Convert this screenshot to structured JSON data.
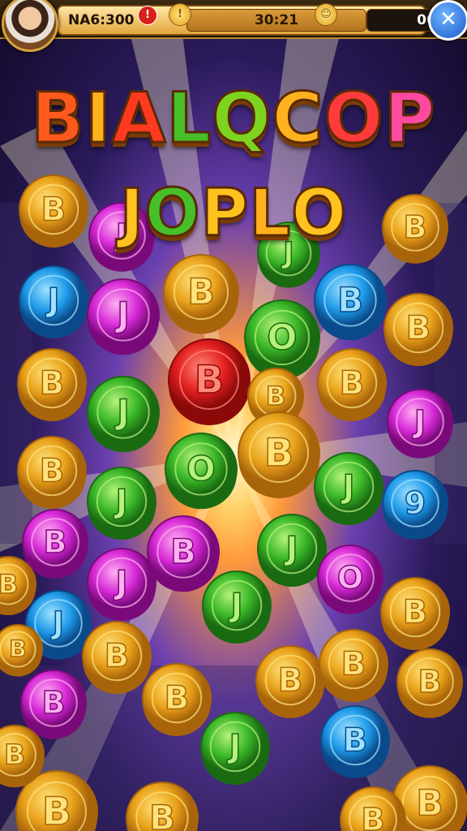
{
  "hud": {
    "player_name": "NA6:300",
    "alert_glyph": "!",
    "coin_glyph": "!",
    "timer": "30:21",
    "score_glyph": "☺",
    "score": "00",
    "close_glyph": "✕"
  },
  "title": {
    "line1": [
      {
        "ch": "B",
        "color": "#ff5a1e"
      },
      {
        "ch": "I",
        "color": "#ffb21e"
      },
      {
        "ch": "A",
        "color": "#ff3a1e"
      },
      {
        "ch": "L",
        "color": "#46c028"
      },
      {
        "ch": "Q",
        "color": "#7ed321"
      },
      {
        "ch": "C",
        "color": "#ffb21e"
      },
      {
        "ch": "O",
        "color": "#ff3a3a"
      },
      {
        "ch": "P",
        "color": "#ff4aa0"
      }
    ],
    "line2": [
      {
        "ch": "J",
        "color": "#ffc21e"
      },
      {
        "ch": "O",
        "color": "#46c028"
      },
      {
        "ch": "P",
        "color": "#ffc21e"
      },
      {
        "ch": "L",
        "color": "#ffb21e"
      },
      {
        "ch": "O",
        "color": "#ffc21e"
      }
    ]
  },
  "palette": {
    "gold": [
      "#ffe37a",
      "#e9a21a",
      "#a8640a"
    ],
    "red": [
      "#ff8a7a",
      "#e21e1e",
      "#8a0a0a"
    ],
    "green": [
      "#b6f27a",
      "#3ab828",
      "#1a6a12"
    ],
    "blue": [
      "#9ee2ff",
      "#1e9ae8",
      "#0a4a8a"
    ],
    "purple": [
      "#ffb0f0",
      "#d82ad8",
      "#7a0a7a"
    ],
    "cyan": [
      "#a8f4ff",
      "#24b8e0",
      "#0a5a7a"
    ]
  },
  "coins": [
    {
      "g": "B",
      "c": "gold"
    },
    {
      "g": "J",
      "c": "purple"
    },
    {
      "g": "J",
      "c": "green"
    },
    {
      "g": "B",
      "c": "gold"
    },
    {
      "g": "J",
      "c": "purple"
    },
    {
      "g": "J",
      "c": "blue"
    },
    {
      "g": "J",
      "c": "purple"
    },
    {
      "g": "B",
      "c": "gold"
    },
    {
      "g": "O",
      "c": "green"
    },
    {
      "g": "B",
      "c": "blue"
    },
    {
      "g": "B",
      "c": "gold"
    },
    {
      "g": "B",
      "c": "gold"
    },
    {
      "g": "B",
      "c": "red"
    },
    {
      "g": "B",
      "c": "gold"
    },
    {
      "g": "B",
      "c": "gold"
    },
    {
      "g": "J",
      "c": "purple"
    },
    {
      "g": "J",
      "c": "green"
    },
    {
      "g": "O",
      "c": "green"
    },
    {
      "g": "B",
      "c": "gold"
    },
    {
      "g": "J",
      "c": "green"
    },
    {
      "g": "B",
      "c": "gold"
    },
    {
      "g": "J",
      "c": "green"
    },
    {
      "g": "9",
      "c": "blue"
    },
    {
      "g": "B",
      "c": "purple"
    },
    {
      "g": "B",
      "c": "purple"
    },
    {
      "g": "J",
      "c": "green"
    },
    {
      "g": "O",
      "c": "purple"
    },
    {
      "g": "J",
      "c": "purple"
    },
    {
      "g": "J",
      "c": "green"
    },
    {
      "g": "B",
      "c": "gold"
    },
    {
      "g": "J",
      "c": "blue"
    },
    {
      "g": "B",
      "c": "gold"
    },
    {
      "g": "B",
      "c": "gold"
    },
    {
      "g": "B",
      "c": "gold"
    },
    {
      "g": "B",
      "c": "purple"
    },
    {
      "g": "J",
      "c": "green"
    },
    {
      "g": "B",
      "c": "blue"
    },
    {
      "g": "B",
      "c": "gold"
    },
    {
      "g": "B",
      "c": "gold"
    },
    {
      "g": "B",
      "c": "gold"
    },
    {
      "g": "B",
      "c": "gold"
    },
    {
      "g": "B",
      "c": "gold"
    },
    {
      "g": "B",
      "c": "gold"
    },
    {
      "g": "B",
      "c": "gold"
    },
    {
      "g": "B",
      "c": "gold"
    },
    {
      "g": "B",
      "c": "gold"
    }
  ]
}
